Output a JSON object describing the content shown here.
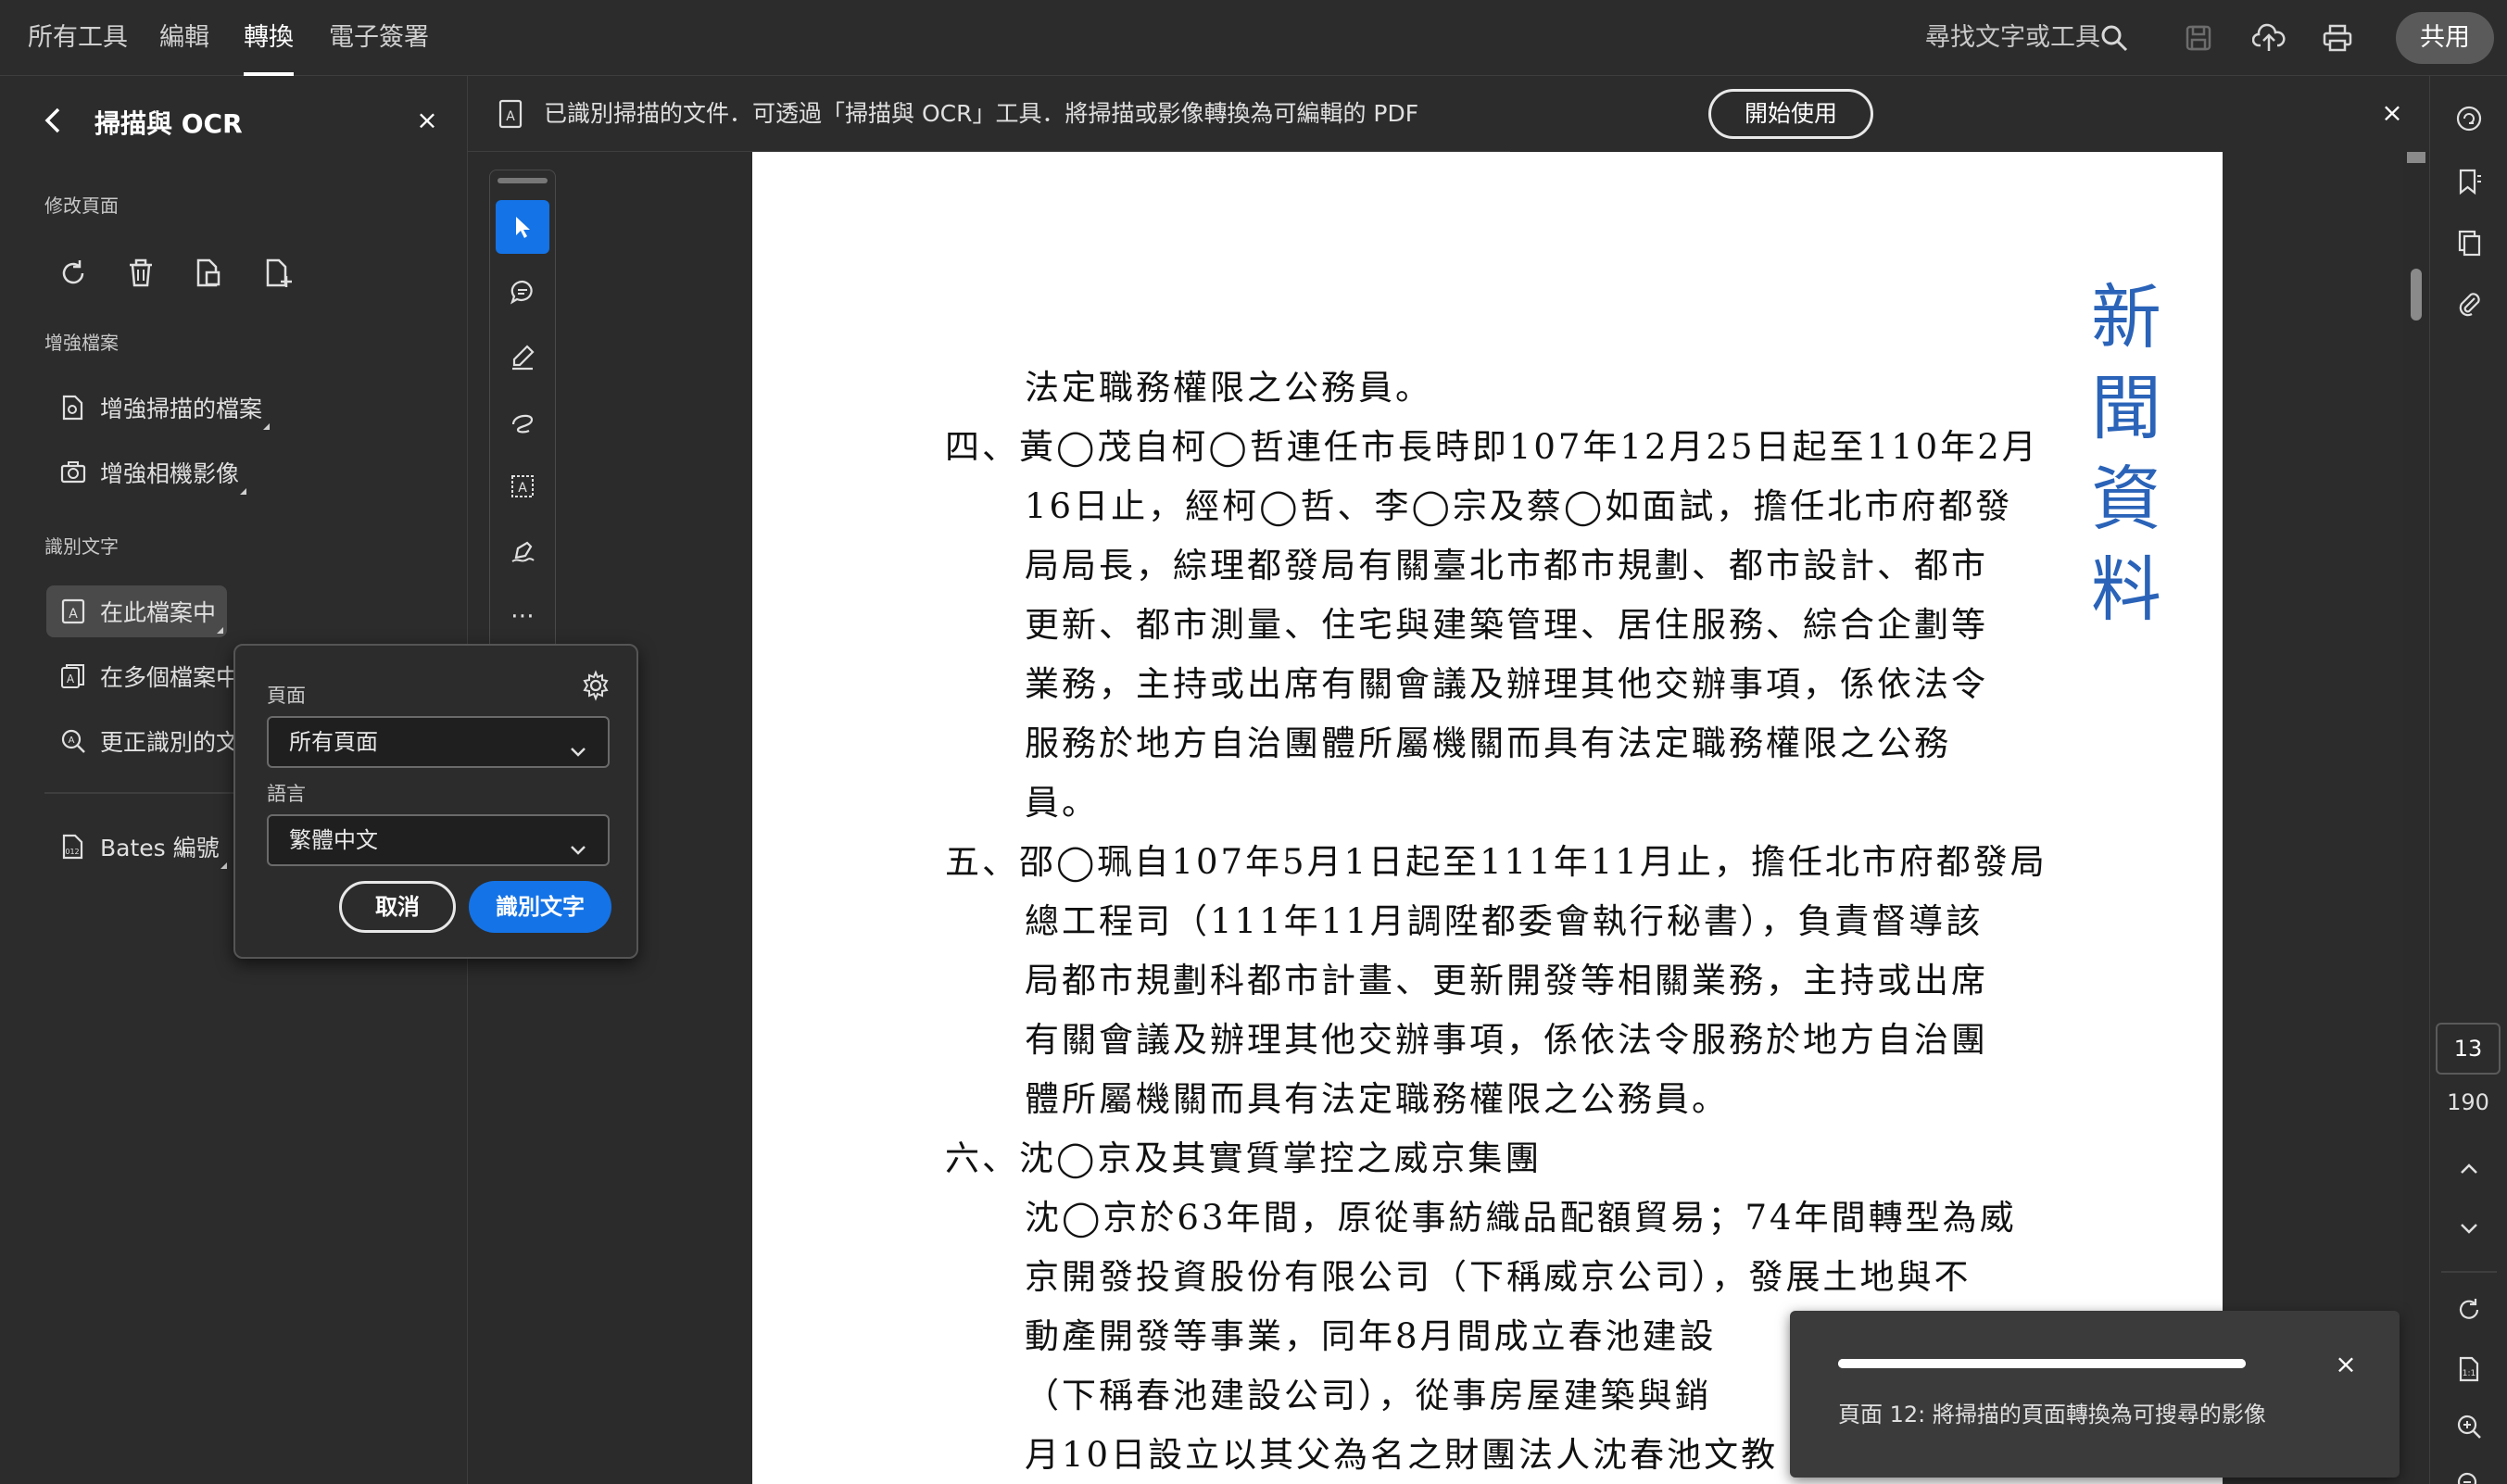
{
  "menu": {
    "tabs": [
      {
        "label": "所有工具"
      },
      {
        "label": "編輯"
      },
      {
        "label": "轉換"
      },
      {
        "label": "電子簽署"
      }
    ],
    "active_tab": "轉換",
    "search_label": "尋找文字或工具",
    "share_label": "共用"
  },
  "panel": {
    "title": "掃描與 OCR",
    "modify_label": "修改頁面",
    "enhance_label": "增強檔案",
    "enhance_scanned": "增強掃描的檔案",
    "enhance_camera": "增強相機影像",
    "recognize_label": "識別文字",
    "in_this_file": "在此檔案中",
    "in_multiple_files": "在多個檔案中",
    "correct_recognized": "更正識別的文",
    "bates": "Bates 編號"
  },
  "popover": {
    "pages_label": "頁面",
    "pages_value": "所有頁面",
    "language_label": "語言",
    "language_value": "繁體中文",
    "cancel": "取消",
    "recognize": "識別文字"
  },
  "notice": {
    "text": "已識別掃描的文件．可透過「掃描與 OCR」工具．將掃描或影像轉換為可編輯的 PDF",
    "start": "開始使用",
    "close": "×"
  },
  "document": {
    "stamp": [
      "新",
      "聞",
      "資",
      "料"
    ],
    "lines": [
      "法定職務權限之公務員。",
      "四、黃◯茂自柯◯哲連任市長時即107年12月25日起至110年2月",
      "16日止，經柯◯哲、李◯宗及蔡◯如面試，擔任北市府都發",
      "局局長，綜理都發局有關臺北市都市規劃、都市設計、都市",
      "更新、都市測量、住宅與建築管理、居住服務、綜合企劃等",
      "業務，主持或出席有關會議及辦理其他交辦事項，係依法令",
      "服務於地方自治團體所屬機關而具有法定職務權限之公務",
      "員。",
      "五、邵◯珮自107年5月1日起至111年11月止，擔任北市府都發局",
      "總工程司（111年11月調陞都委會執行秘書），負責督導該",
      "局都市規劃科都市計畫、更新開發等相關業務，主持或出席",
      "有關會議及辦理其他交辦事項，係依法令服務於地方自治團",
      "體所屬機關而具有法定職務權限之公務員。",
      "六、沈◯京及其實質掌控之威京集團",
      "沈◯京於63年間，原從事紡織品配額貿易；74年間轉型為威",
      "京開發投資股份有限公司（下稱威京公司），發展土地與不",
      "動產開發等事業，同年8月間成立春池建設",
      "（下稱春池建設公司），從事房屋建築與銷",
      "月10日設立以其父為名之財團法人沈春池文教"
    ]
  },
  "page_nav": {
    "current": "13",
    "total": "190"
  },
  "toast": {
    "text": "頁面 12: 將掃描的頁面轉換為可搜尋的影像",
    "progress": 1.0,
    "close": "×"
  },
  "colors": {
    "accent": "#1473e6",
    "stamp": "#2a63b8",
    "background": "#2c2c2c"
  }
}
